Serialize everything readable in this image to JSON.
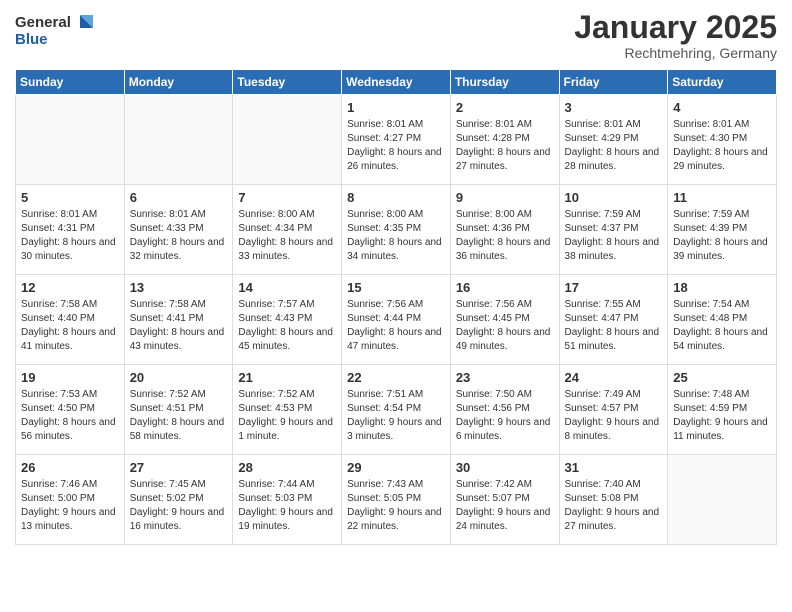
{
  "header": {
    "logo_general": "General",
    "logo_blue": "Blue",
    "title": "January 2025",
    "subtitle": "Rechtmehring, Germany"
  },
  "weekdays": [
    "Sunday",
    "Monday",
    "Tuesday",
    "Wednesday",
    "Thursday",
    "Friday",
    "Saturday"
  ],
  "weeks": [
    [
      {
        "day": "",
        "info": ""
      },
      {
        "day": "",
        "info": ""
      },
      {
        "day": "",
        "info": ""
      },
      {
        "day": "1",
        "info": "Sunrise: 8:01 AM\nSunset: 4:27 PM\nDaylight: 8 hours and 26 minutes."
      },
      {
        "day": "2",
        "info": "Sunrise: 8:01 AM\nSunset: 4:28 PM\nDaylight: 8 hours and 27 minutes."
      },
      {
        "day": "3",
        "info": "Sunrise: 8:01 AM\nSunset: 4:29 PM\nDaylight: 8 hours and 28 minutes."
      },
      {
        "day": "4",
        "info": "Sunrise: 8:01 AM\nSunset: 4:30 PM\nDaylight: 8 hours and 29 minutes."
      }
    ],
    [
      {
        "day": "5",
        "info": "Sunrise: 8:01 AM\nSunset: 4:31 PM\nDaylight: 8 hours and 30 minutes."
      },
      {
        "day": "6",
        "info": "Sunrise: 8:01 AM\nSunset: 4:33 PM\nDaylight: 8 hours and 32 minutes."
      },
      {
        "day": "7",
        "info": "Sunrise: 8:00 AM\nSunset: 4:34 PM\nDaylight: 8 hours and 33 minutes."
      },
      {
        "day": "8",
        "info": "Sunrise: 8:00 AM\nSunset: 4:35 PM\nDaylight: 8 hours and 34 minutes."
      },
      {
        "day": "9",
        "info": "Sunrise: 8:00 AM\nSunset: 4:36 PM\nDaylight: 8 hours and 36 minutes."
      },
      {
        "day": "10",
        "info": "Sunrise: 7:59 AM\nSunset: 4:37 PM\nDaylight: 8 hours and 38 minutes."
      },
      {
        "day": "11",
        "info": "Sunrise: 7:59 AM\nSunset: 4:39 PM\nDaylight: 8 hours and 39 minutes."
      }
    ],
    [
      {
        "day": "12",
        "info": "Sunrise: 7:58 AM\nSunset: 4:40 PM\nDaylight: 8 hours and 41 minutes."
      },
      {
        "day": "13",
        "info": "Sunrise: 7:58 AM\nSunset: 4:41 PM\nDaylight: 8 hours and 43 minutes."
      },
      {
        "day": "14",
        "info": "Sunrise: 7:57 AM\nSunset: 4:43 PM\nDaylight: 8 hours and 45 minutes."
      },
      {
        "day": "15",
        "info": "Sunrise: 7:56 AM\nSunset: 4:44 PM\nDaylight: 8 hours and 47 minutes."
      },
      {
        "day": "16",
        "info": "Sunrise: 7:56 AM\nSunset: 4:45 PM\nDaylight: 8 hours and 49 minutes."
      },
      {
        "day": "17",
        "info": "Sunrise: 7:55 AM\nSunset: 4:47 PM\nDaylight: 8 hours and 51 minutes."
      },
      {
        "day": "18",
        "info": "Sunrise: 7:54 AM\nSunset: 4:48 PM\nDaylight: 8 hours and 54 minutes."
      }
    ],
    [
      {
        "day": "19",
        "info": "Sunrise: 7:53 AM\nSunset: 4:50 PM\nDaylight: 8 hours and 56 minutes."
      },
      {
        "day": "20",
        "info": "Sunrise: 7:52 AM\nSunset: 4:51 PM\nDaylight: 8 hours and 58 minutes."
      },
      {
        "day": "21",
        "info": "Sunrise: 7:52 AM\nSunset: 4:53 PM\nDaylight: 9 hours and 1 minute."
      },
      {
        "day": "22",
        "info": "Sunrise: 7:51 AM\nSunset: 4:54 PM\nDaylight: 9 hours and 3 minutes."
      },
      {
        "day": "23",
        "info": "Sunrise: 7:50 AM\nSunset: 4:56 PM\nDaylight: 9 hours and 6 minutes."
      },
      {
        "day": "24",
        "info": "Sunrise: 7:49 AM\nSunset: 4:57 PM\nDaylight: 9 hours and 8 minutes."
      },
      {
        "day": "25",
        "info": "Sunrise: 7:48 AM\nSunset: 4:59 PM\nDaylight: 9 hours and 11 minutes."
      }
    ],
    [
      {
        "day": "26",
        "info": "Sunrise: 7:46 AM\nSunset: 5:00 PM\nDaylight: 9 hours and 13 minutes."
      },
      {
        "day": "27",
        "info": "Sunrise: 7:45 AM\nSunset: 5:02 PM\nDaylight: 9 hours and 16 minutes."
      },
      {
        "day": "28",
        "info": "Sunrise: 7:44 AM\nSunset: 5:03 PM\nDaylight: 9 hours and 19 minutes."
      },
      {
        "day": "29",
        "info": "Sunrise: 7:43 AM\nSunset: 5:05 PM\nDaylight: 9 hours and 22 minutes."
      },
      {
        "day": "30",
        "info": "Sunrise: 7:42 AM\nSunset: 5:07 PM\nDaylight: 9 hours and 24 minutes."
      },
      {
        "day": "31",
        "info": "Sunrise: 7:40 AM\nSunset: 5:08 PM\nDaylight: 9 hours and 27 minutes."
      },
      {
        "day": "",
        "info": ""
      }
    ]
  ]
}
